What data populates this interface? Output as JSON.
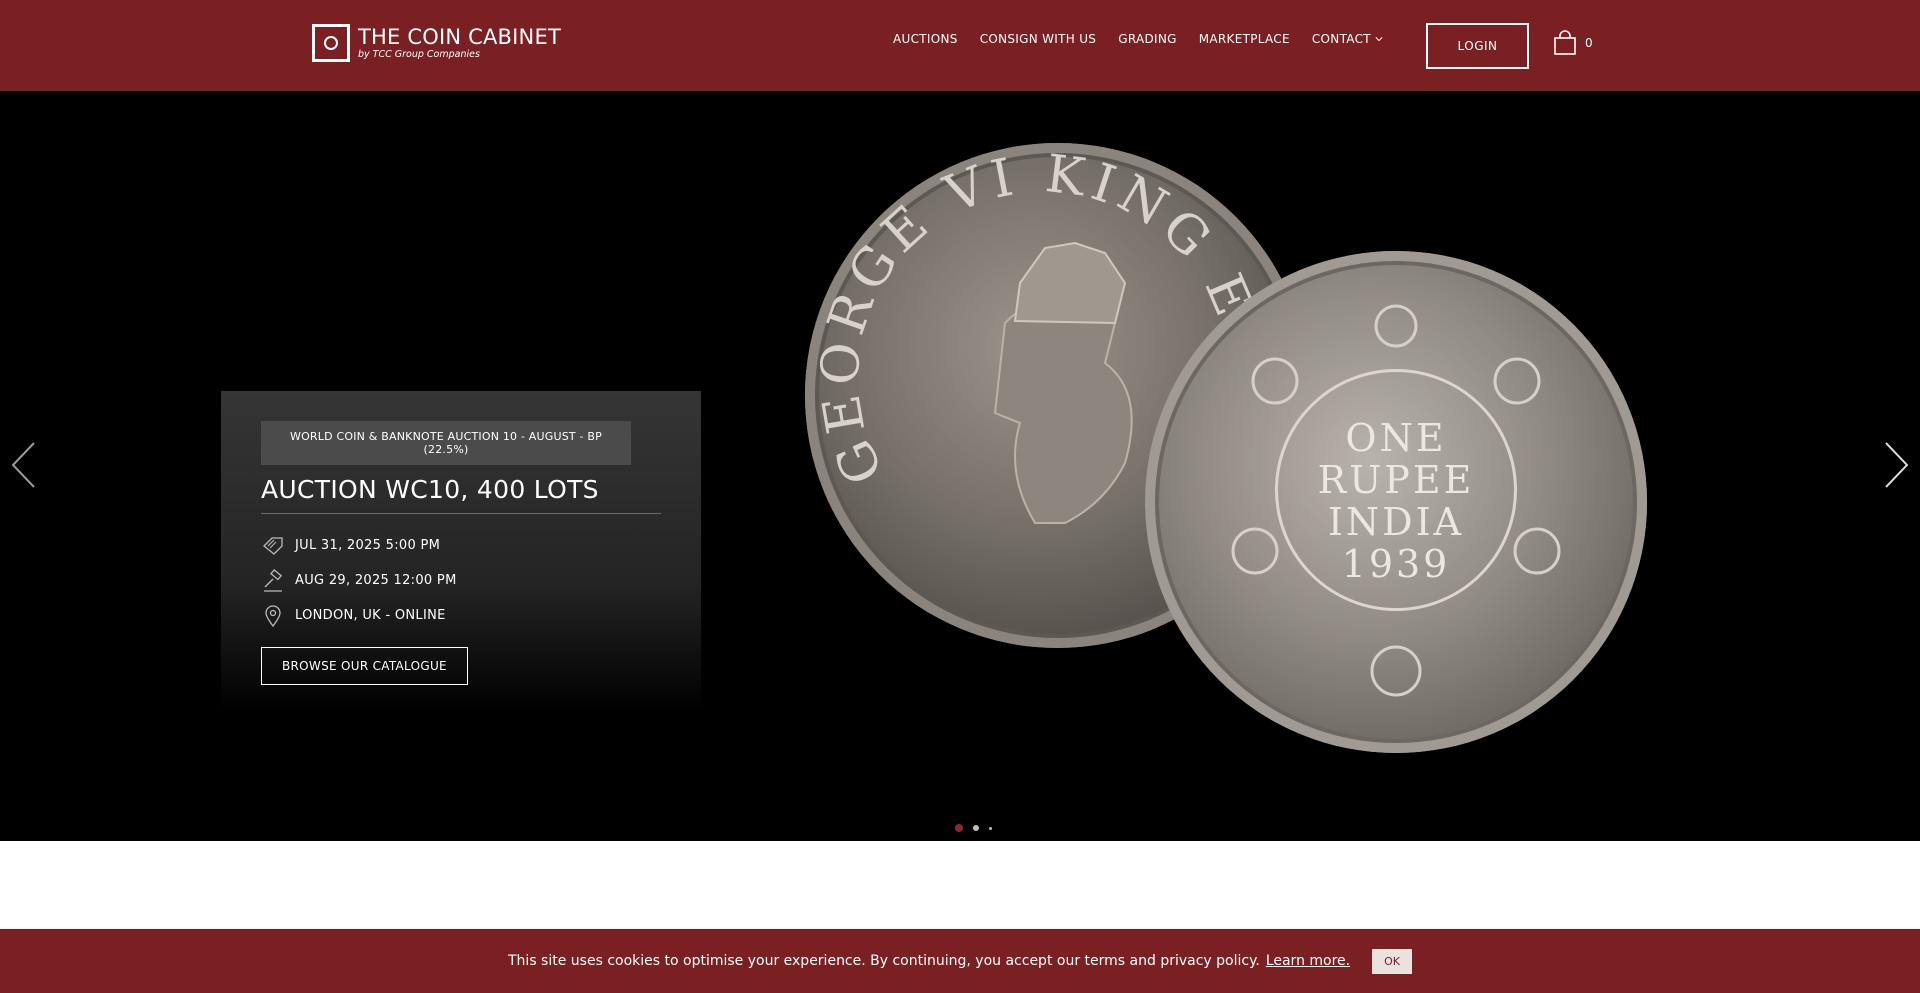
{
  "header": {
    "logo_title": "THE COIN CABINET",
    "logo_subtitle": "by TCC Group Companies",
    "nav": [
      "AUCTIONS",
      "CONSIGN WITH US",
      "GRADING",
      "MARKETPLACE",
      "CONTACT"
    ],
    "login_label": "LOGIN",
    "cart_count": "0"
  },
  "hero": {
    "tag": "WORLD COIN & BANKNOTE AUCTION 10 - AUGUST - BP (22.5%)",
    "title": "AUCTION WC10, 400 LOTS",
    "start": "JUL 31, 2025 5:00 PM",
    "end": "AUG 29, 2025 12:00 PM",
    "location": "LONDON, UK - ONLINE",
    "cta_label": "BROWSE OUR CATALOGUE",
    "coin_obverse_text": "GEORGE VI KING E",
    "coin_reverse_text": [
      "ONE",
      "RUPEE",
      "INDIA",
      "1939"
    ]
  },
  "cookie": {
    "message": "This site uses cookies to optimise your experience. By continuing, you accept our terms and privacy policy.",
    "learn_more": "Learn more.",
    "ok": "OK"
  },
  "colors": {
    "brand": "#7a2022",
    "hero_bg": "#000000"
  }
}
